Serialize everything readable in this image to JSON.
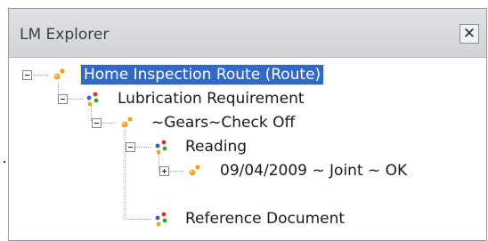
{
  "panel": {
    "title": "LM Explorer",
    "close_symbol": "✕"
  },
  "tree": {
    "nodes": [
      {
        "label": "Home Inspection Route (Route)",
        "icon": "route-icon",
        "expander": "minus",
        "selected": true
      },
      {
        "label": "Lubrication Requirement",
        "icon": "family-icon",
        "expander": "minus",
        "selected": false
      },
      {
        "label": "~Gears~Check Off",
        "icon": "route-icon",
        "expander": "minus",
        "selected": false
      },
      {
        "label": "Reading",
        "icon": "family-icon",
        "expander": "minus",
        "selected": false
      },
      {
        "label": "09/04/2009 ~ Joint ~ OK",
        "icon": "route-icon",
        "expander": "plus",
        "selected": false
      },
      {
        "label": "Reference Document",
        "icon": "family-icon",
        "expander": "none",
        "selected": false
      }
    ]
  },
  "colors": {
    "selection": "#3169c6",
    "title_bar": "#d2d4d8",
    "icon_orange": "#f5a21b",
    "icon_red": "#e8262b",
    "icon_green": "#2fa836",
    "icon_blue": "#2f5fcf"
  }
}
